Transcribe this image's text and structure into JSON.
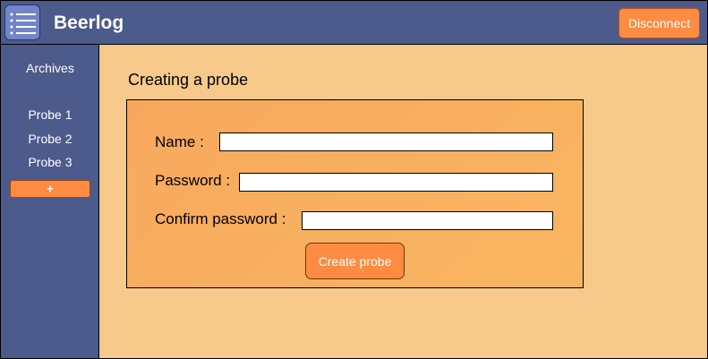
{
  "header": {
    "title": "Beerlog",
    "menu_icon": "list-menu-icon",
    "disconnect_label": "Disconnect"
  },
  "sidebar": {
    "archives_label": "Archives",
    "items": [
      {
        "label": "Probe 1"
      },
      {
        "label": "Probe 2"
      },
      {
        "label": "Probe 3"
      }
    ],
    "add_label": "+"
  },
  "main": {
    "title": "Creating a probe",
    "form": {
      "name_label": "Name :",
      "name_value": "",
      "password_label": "Password :",
      "password_value": "",
      "confirm_label": "Confirm password :",
      "confirm_value": "",
      "submit_label": "Create probe"
    }
  },
  "colors": {
    "header_bg": "#4d5a8c",
    "page_bg": "#f7c98a",
    "accent": "#fd8b42",
    "panel_bg": "#f8a85d"
  }
}
